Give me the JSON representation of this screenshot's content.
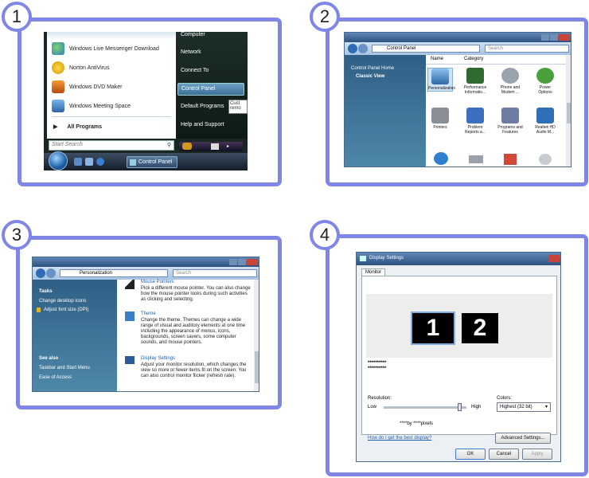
{
  "badges": [
    "1",
    "2",
    "3",
    "4"
  ],
  "panel1": {
    "left_items": [
      "Windows Live Messenger Download",
      "Norton AntiVirus",
      "Windows DVD Maker",
      "Windows Meeting Space"
    ],
    "all_programs": "All Programs",
    "search_placeholder": "Start Search",
    "right_items": [
      "Computer",
      "Network",
      "Connect To",
      "Control Panel",
      "Default Programs",
      "Help and Support"
    ],
    "tooltip": "Cust remo",
    "taskbar_button": "Control Panel"
  },
  "panel2": {
    "address": "Control Panel",
    "search_placeholder": "Search",
    "sidebar": [
      "Control Panel Home",
      "Classic View"
    ],
    "columns": [
      "Name",
      "Category"
    ],
    "icons": [
      {
        "label": "Personalization",
        "color": "#5e8fc9"
      },
      {
        "label": "Performance Informatio...",
        "color": "#2f6b2f"
      },
      {
        "label": "Phone and Modem ...",
        "color": "#9aa3ad"
      },
      {
        "label": "Power Options",
        "color": "#4aa13c"
      },
      {
        "label": "Printers",
        "color": "#8a8f96"
      },
      {
        "label": "Problem Reports a...",
        "color": "#3c6fbf"
      },
      {
        "label": "Programs and Features",
        "color": "#6d7ca0"
      },
      {
        "label": "Realtek HD Audio M...",
        "color": "#2f6fb8"
      }
    ]
  },
  "panel3": {
    "address": "Personalization",
    "search_placeholder": "Search",
    "tasks_title": "Tasks",
    "tasks": [
      "Change desktop icons",
      "Adjust font size (DPI)"
    ],
    "see_also_title": "See also",
    "see_also": [
      "Taskbar and Start Menu",
      "Ease of Access"
    ],
    "mouse_heading": "Mouse Pointers",
    "mouse_text": "Pick a different mouse pointer. You can also change how the mouse pointer looks during such activities as clicking and selecting.",
    "theme_heading": "Theme",
    "theme_text": "Change the theme. Themes can change a wide range of visual and auditory elements at one time including the appearance of menus, icons, backgrounds, screen savers, some computer sounds, and mouse pointers.",
    "display_heading": "Display Settings",
    "display_text": "Adjust your monitor resolution, which changes the view so more or fewer items fit on the screen. You can also control monitor flicker (refresh rate)."
  },
  "panel4": {
    "title": "Display Settings",
    "tab": "Monitor",
    "monitor1": "1",
    "monitor2": "2",
    "device_line1": "**********",
    "device_line2": "**********",
    "resolution_label": "Resolution:",
    "low": "Low",
    "high": "High",
    "resolution_value": "****by ****pixels",
    "resolution_level": 0.95,
    "colors_label": "Colors:",
    "colors_value": "Highest (32 bit)",
    "help_link": "How do I get the best display?",
    "advanced": "Advanced Settings...",
    "ok": "OK",
    "cancel": "Cancel",
    "apply": "Apply"
  }
}
